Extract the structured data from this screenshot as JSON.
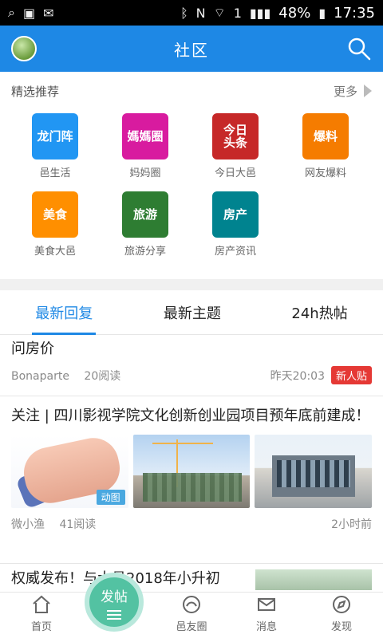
{
  "status_bar": {
    "battery": "48%",
    "time": "17:35"
  },
  "header": {
    "title": "社区"
  },
  "featured": {
    "label": "精选推荐",
    "more_label": "更多",
    "tiles": [
      {
        "icon_text": "龙门阵",
        "caption": "邑生活",
        "color": "#2196f3"
      },
      {
        "icon_text": "媽媽圈",
        "caption": "妈妈圈",
        "color": "#d81b9f"
      },
      {
        "icon_text": "今日\n头条",
        "caption": "今日大邑",
        "color": "#c62828"
      },
      {
        "icon_text": "爆料",
        "caption": "网友爆料",
        "color": "#f57c00"
      },
      {
        "icon_text": "美食",
        "caption": "美食大邑",
        "color": "#ff8f00"
      },
      {
        "icon_text": "旅游",
        "caption": "旅游分享",
        "color": "#2e7d32"
      },
      {
        "icon_text": "房产",
        "caption": "房产资讯",
        "color": "#00838f"
      }
    ]
  },
  "tabs": [
    {
      "label": "最新回复",
      "active": true
    },
    {
      "label": "最新主题",
      "active": false
    },
    {
      "label": "24h热帖",
      "active": false
    }
  ],
  "posts": [
    {
      "title": "问房价",
      "author": "Bonaparte",
      "reads": "20阅读",
      "time": "昨天20:03",
      "badge": "新人贴"
    },
    {
      "title": "关注 | 四川影视学院文化创新创业园项目预年底前建成！",
      "author": "微小渔",
      "reads": "41阅读",
      "time": "2小时前",
      "image_tag": "动图"
    },
    {
      "title": "权威发布！与大邑2018年小升初"
    }
  ],
  "bottom_nav": {
    "home": "首页",
    "post": "发帖",
    "circle": "邑友圈",
    "messages": "消息",
    "discover": "发现"
  }
}
